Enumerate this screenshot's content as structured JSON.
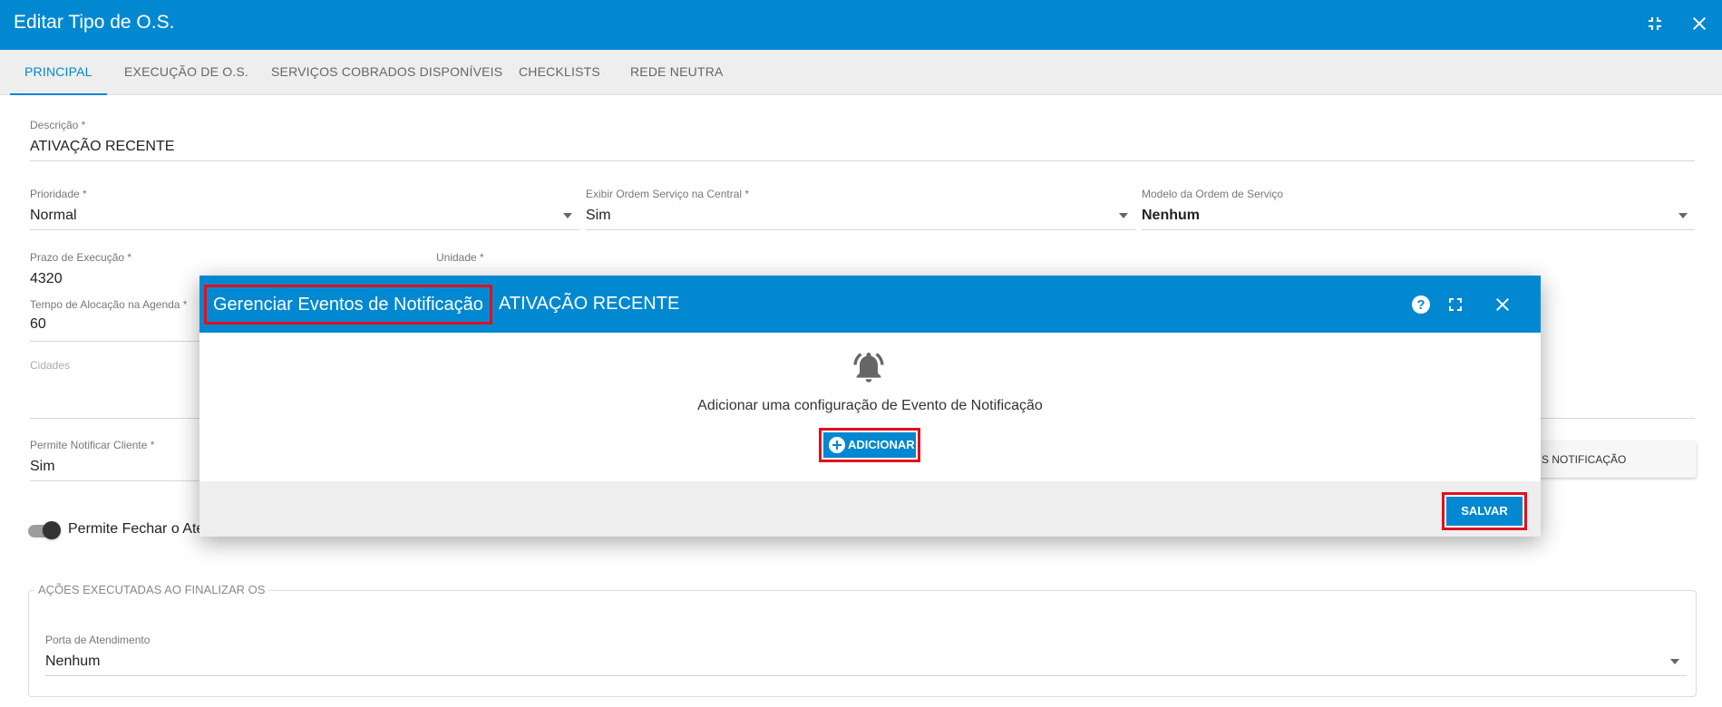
{
  "window": {
    "title": "Editar Tipo de O.S."
  },
  "tabs": [
    {
      "label": "PRINCIPAL",
      "active": true
    },
    {
      "label": "EXECUÇÃO DE O.S."
    },
    {
      "label": "SERVIÇOS COBRADOS DISPONÍVEIS"
    },
    {
      "label": "CHECKLISTS"
    },
    {
      "label": "REDE NEUTRA"
    }
  ],
  "form": {
    "descricao": {
      "label": "Descrição *",
      "value": "ATIVAÇÃO RECENTE"
    },
    "prioridade": {
      "label": "Prioridade *",
      "value": "Normal"
    },
    "exibir": {
      "label": "Exibir Ordem Serviço na Central *",
      "value": "Sim"
    },
    "modelo": {
      "label": "Modelo da Ordem de Serviço",
      "value": "Nenhum"
    },
    "prazo": {
      "label": "Prazo de Execução *",
      "value": "4320"
    },
    "unidade": {
      "label": "Unidade *"
    },
    "tempo": {
      "label": "Tempo de Alocação na Agenda *",
      "value": "60"
    },
    "cidades": {
      "label": "Cidades"
    },
    "permite_notificar": {
      "label": "Permite Notificar Cliente *",
      "value": "Sim"
    },
    "notificacao_button": "S NOTIFICAÇÃO",
    "toggle_label": "Permite Fechar o Ate",
    "acoes": {
      "legend": "AÇÕES EXECUTADAS AO FINALIZAR OS",
      "porta": {
        "label": "Porta de Atendimento",
        "value": "Nenhum"
      }
    }
  },
  "modal": {
    "title": "Gerenciar Eventos de Notificação",
    "subtitle": "ATIVAÇÃO RECENTE",
    "message": "Adicionar uma configuração de Evento de Notificação",
    "add_label": "ADICIONAR",
    "save_label": "SALVAR",
    "icons": [
      "help-icon",
      "fullscreen-icon",
      "close-icon",
      "bell-icon"
    ]
  },
  "colors": {
    "primary": "#0288d1",
    "highlight": "#e0101d"
  }
}
